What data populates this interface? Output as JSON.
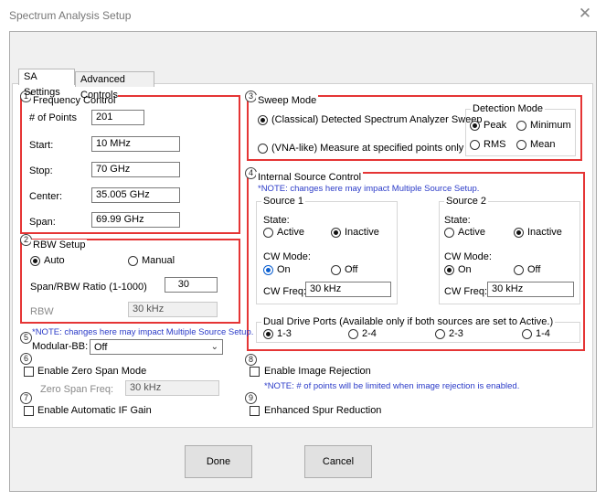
{
  "window": {
    "title": "Spectrum Analysis Setup",
    "close_glyph": "✕"
  },
  "tabs": [
    {
      "label": "SA Settings",
      "active": true
    },
    {
      "label": "Advanced Controls",
      "active": false
    }
  ],
  "markers": [
    "1",
    "2",
    "3",
    "4",
    "5",
    "6",
    "7",
    "8",
    "9"
  ],
  "frequency_control": {
    "title": "Frequency Control",
    "points_label": "# of Points",
    "points_value": "201",
    "start_label": "Start:",
    "start_value": "10 MHz",
    "stop_label": "Stop:",
    "stop_value": "70 GHz",
    "center_label": "Center:",
    "center_value": "35.005 GHz",
    "span_label": "Span:",
    "span_value": "69.99 GHz"
  },
  "rbw_setup": {
    "title": "RBW Setup",
    "auto_label": "Auto",
    "manual_label": "Manual",
    "ratio_label": "Span/RBW Ratio (1-1000)",
    "ratio_value": "30",
    "rbw_label": "RBW",
    "rbw_value": "30 kHz"
  },
  "sweep_mode": {
    "title": "Sweep Mode",
    "classical_label": "(Classical) Detected Spectrum Analyzer Sweep",
    "vna_label": "(VNA-like) Measure at specified points only",
    "detection_title": "Detection Mode",
    "peak_label": "Peak",
    "minimum_label": "Minimum",
    "rms_label": "RMS",
    "mean_label": "Mean"
  },
  "internal_source": {
    "title": "Internal Source Control",
    "note": "*NOTE: changes here may impact Multiple Source Setup.",
    "source1": {
      "title": "Source 1",
      "state_label": "State:",
      "active_label": "Active",
      "inactive_label": "Inactive",
      "cw_mode_label": "CW Mode:",
      "on_label": "On",
      "off_label": "Off",
      "cw_freq_label": "CW Freq:",
      "cw_freq_value": "30 kHz"
    },
    "source2": {
      "title": "Source 2",
      "state_label": "State:",
      "active_label": "Active",
      "inactive_label": "Inactive",
      "cw_mode_label": "CW Mode:",
      "on_label": "On",
      "off_label": "Off",
      "cw_freq_label": "CW Freq:",
      "cw_freq_value": "30 kHz"
    },
    "dual_drive": {
      "title": "Dual Drive Ports (Available only if both sources are set to Active.)",
      "options": [
        "1-3",
        "2-4",
        "2-3",
        "1-4"
      ]
    }
  },
  "modular_bb": {
    "note": "*NOTE: changes here may impact Multiple Source Setup.",
    "label": "Modular-BB:",
    "value": "Off"
  },
  "zero_span": {
    "label": "Enable Zero Span Mode",
    "freq_label": "Zero Span Freq:",
    "freq_value": "30 kHz"
  },
  "auto_if": {
    "label": "Enable Automatic IF Gain"
  },
  "image_rejection": {
    "label": "Enable Image Rejection",
    "note": "*NOTE:  # of points will be limited when image rejection is enabled."
  },
  "spur_reduction": {
    "label": "Enhanced Spur Reduction"
  },
  "buttons": {
    "done": "Done",
    "cancel": "Cancel"
  },
  "colors": {
    "highlight_border": "#e53535",
    "note_text": "#2b3bc8",
    "radio_selected_blue": "#0b5fd0"
  }
}
